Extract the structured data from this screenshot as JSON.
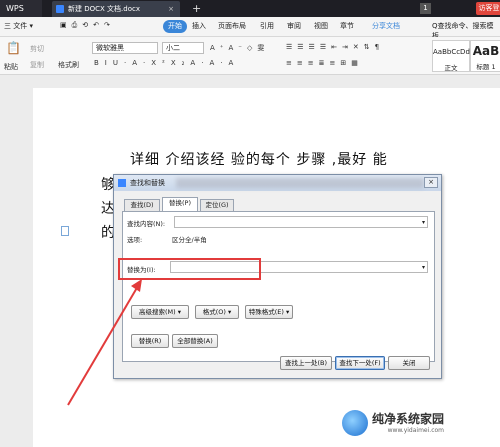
{
  "titlebar": {
    "app": "WPS",
    "doc_tab": "新建 DOCX 文档.docx",
    "tab_close": "×",
    "new_tab": "+",
    "badge": "1",
    "login": "访客登"
  },
  "menubar": {
    "file": "三 文件 ▾",
    "start": "开始",
    "items": [
      "插入",
      "页面布局",
      "引用",
      "审阅",
      "视图",
      "章节"
    ],
    "share": "分享文档",
    "search": "Q查找命令、搜索模板"
  },
  "toolbar": {
    "paste": "粘贴",
    "cut": "剪切",
    "copy": "复制",
    "format_painter": "格式刷",
    "font": "微软雅黑",
    "size": "小二",
    "style1_preview": "AaBbCcDd",
    "style1_label": "正文",
    "style2_preview": "AaB",
    "style2_label": "标题 1"
  },
  "document": {
    "line1": "详细   介绍该经    验的每个  步骤 ,最好    能",
    "gutter": [
      "够",
      "达",
      "的"
    ]
  },
  "dialog": {
    "title": "查找和替换",
    "close": "×",
    "tabs": [
      "查找(D)",
      "替换(P)",
      "定位(G)"
    ],
    "find_label": "查找内容(N):",
    "find_value": "",
    "options_label": "选项:",
    "options_value": "区分全/半角",
    "replace_label": "替换为(I):",
    "replace_value": "",
    "advanced_btn": "高级搜索(M) ▾",
    "format_btn": "格式(O) ▾",
    "special_btn": "特殊格式(E) ▾",
    "replace_btn": "替换(R)",
    "replace_all_btn": "全部替换(A)",
    "find_prev_btn": "查找上一处(B)",
    "find_next_btn": "查找下一处(F)",
    "close_btn": "关闭"
  },
  "watermark": {
    "title": "纯净系统家园",
    "url": "www.yidaimei.com"
  },
  "colors": {
    "accent": "#3a86d8",
    "highlight": "#e23b3b"
  }
}
